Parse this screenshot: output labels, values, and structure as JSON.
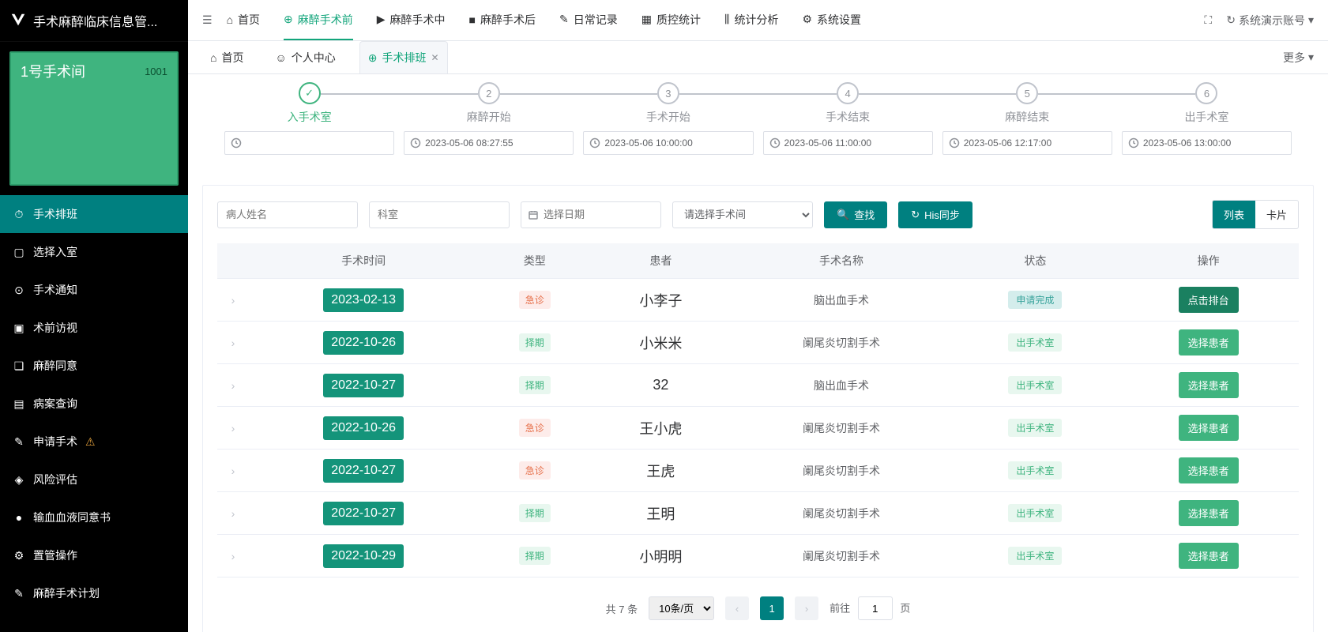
{
  "app_title": "手术麻醉临床信息管...",
  "room": {
    "name": "1号手术间",
    "code": "1001"
  },
  "sidebar_menu": [
    {
      "icon": "⏱",
      "label": "手术排班",
      "active": true
    },
    {
      "icon": "▢",
      "label": "选择入室"
    },
    {
      "icon": "⊙",
      "label": "手术通知"
    },
    {
      "icon": "▣",
      "label": "术前访视"
    },
    {
      "icon": "❏",
      "label": "麻醉同意"
    },
    {
      "icon": "▤",
      "label": "病案查询"
    },
    {
      "icon": "✎",
      "label": "申请手术",
      "warn": true
    },
    {
      "icon": "◈",
      "label": "风险评估"
    },
    {
      "icon": "●",
      "label": "输血血液同意书"
    },
    {
      "icon": "⚙",
      "label": "置管操作"
    },
    {
      "icon": "✎",
      "label": "麻醉手术计划"
    }
  ],
  "topnav": [
    {
      "icon": "⌂",
      "label": "首页"
    },
    {
      "icon": "⊕",
      "label": "麻醉手术前",
      "active": true
    },
    {
      "icon": "▶",
      "label": "麻醉手术中"
    },
    {
      "icon": "■",
      "label": "麻醉手术后"
    },
    {
      "icon": "✎",
      "label": "日常记录"
    },
    {
      "icon": "▦",
      "label": "质控统计"
    },
    {
      "icon": "⫼",
      "label": "统计分析"
    },
    {
      "icon": "⚙",
      "label": "系统设置"
    }
  ],
  "account_label": "系统演示账号",
  "subtabs": [
    {
      "icon": "⌂",
      "label": "首页"
    },
    {
      "icon": "☺",
      "label": "个人中心"
    },
    {
      "icon": "⊕",
      "label": "手术排班",
      "active": true,
      "closable": true
    }
  ],
  "more_label": "更多",
  "steps": [
    {
      "num": "✓",
      "label": "入手术室",
      "value": "",
      "active": true
    },
    {
      "num": "2",
      "label": "麻醉开始",
      "value": "2023-05-06 08:27:55"
    },
    {
      "num": "3",
      "label": "手术开始",
      "value": "2023-05-06 10:00:00"
    },
    {
      "num": "4",
      "label": "手术结束",
      "value": "2023-05-06 11:00:00"
    },
    {
      "num": "5",
      "label": "麻醉结束",
      "value": "2023-05-06 12:17:00"
    },
    {
      "num": "6",
      "label": "出手术室",
      "value": "2023-05-06 13:00:00"
    }
  ],
  "filter": {
    "patient_ph": "病人姓名",
    "dept_ph": "科室",
    "date_ph": "选择日期",
    "room_ph": "请选择手术间",
    "search_btn": "查找",
    "sync_btn": "His同步",
    "view_list": "列表",
    "view_card": "卡片"
  },
  "columns": [
    "手术时间",
    "类型",
    "患者",
    "手术名称",
    "状态",
    "操作"
  ],
  "type_labels": {
    "急诊": "急诊",
    "择期": "择期"
  },
  "status_labels": {
    "out": "出手术室",
    "apply": "申请完成"
  },
  "op_labels": {
    "select": "选择患者",
    "schedule": "点击排台"
  },
  "rows": [
    {
      "date": "2023-02-13",
      "type": "急诊",
      "patient": "小李子",
      "surgery": "脑出血手术",
      "status": "apply",
      "op": "schedule"
    },
    {
      "date": "2022-10-26",
      "type": "择期",
      "patient": "小米米",
      "surgery": "阑尾炎切割手术",
      "status": "out",
      "op": "select"
    },
    {
      "date": "2022-10-27",
      "type": "择期",
      "patient": "32",
      "surgery": "脑出血手术",
      "status": "out",
      "op": "select"
    },
    {
      "date": "2022-10-26",
      "type": "急诊",
      "patient": "王小虎",
      "surgery": "阑尾炎切割手术",
      "status": "out",
      "op": "select"
    },
    {
      "date": "2022-10-27",
      "type": "急诊",
      "patient": "王虎",
      "surgery": "阑尾炎切割手术",
      "status": "out",
      "op": "select"
    },
    {
      "date": "2022-10-27",
      "type": "择期",
      "patient": "王明",
      "surgery": "阑尾炎切割手术",
      "status": "out",
      "op": "select"
    },
    {
      "date": "2022-10-29",
      "type": "择期",
      "patient": "小明明",
      "surgery": "阑尾炎切割手术",
      "status": "out",
      "op": "select"
    }
  ],
  "pager": {
    "total_text": "共 7 条",
    "size_label": "10条/页",
    "current": "1",
    "jump_prefix": "前往",
    "jump_value": "1",
    "jump_suffix": "页"
  }
}
